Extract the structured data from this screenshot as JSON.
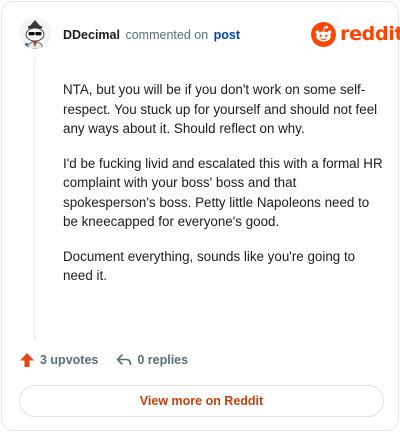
{
  "header": {
    "username": "DDecimal",
    "commented_text": "commented on",
    "post_link": "post",
    "brand_name": "reddit"
  },
  "comment": {
    "paragraphs": [
      "NTA, but you will be if you don't work on some self-respect. You stuck up for yourself and should not feel any ways about it. Should reflect on why.",
      "I'd be fucking livid and escalated this with a formal HR complaint with your boss' boss and that spokesperson's boss. Petty little Napoleons need to be kneecapped for everyone's good.",
      "Document everything, sounds like you're going to need it."
    ]
  },
  "actions": {
    "upvotes_label": "3 upvotes",
    "replies_label": "0 replies"
  },
  "footer": {
    "view_more_label": "View more on Reddit"
  },
  "icons": {
    "upvote": "upvote-arrow-icon",
    "reply": "reply-arrow-icon",
    "brand": "reddit-logo-icon",
    "avatar": "snoo-avatar-icon"
  },
  "colors": {
    "brand": "#ff4500",
    "link": "#0045ac",
    "muted": "#576f76",
    "view_more": "#c2410c"
  }
}
